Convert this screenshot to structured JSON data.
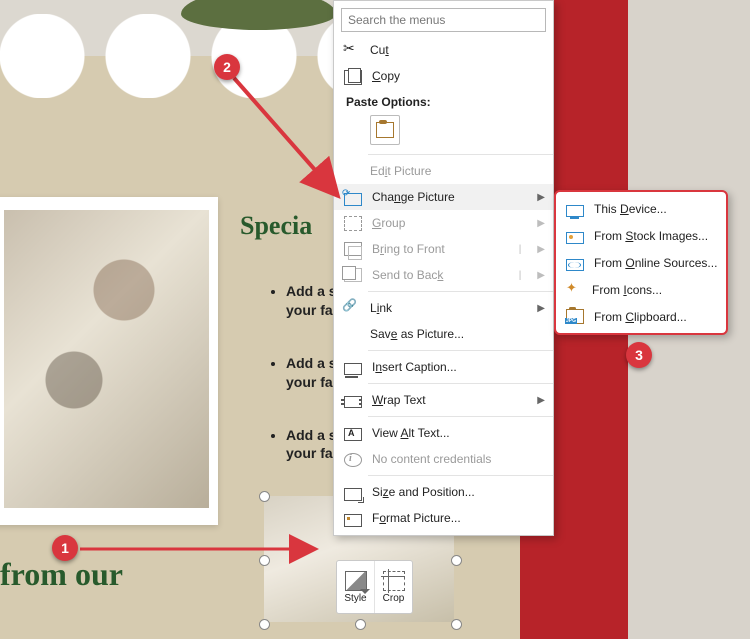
{
  "document": {
    "heading": "Specia",
    "bullets": [
      "Add a s",
      "Add a s",
      "Add a s"
    ],
    "bullet_line2": "your fa",
    "footer_heading": "from our"
  },
  "context_menu": {
    "search_placeholder": "Search the menus",
    "cut": "Cut",
    "copy": "Copy",
    "paste_options_header": "Paste Options:",
    "edit_picture": "Edit Picture",
    "change_picture": "Change Picture",
    "group": "Group",
    "bring_to_front": "Bring to Front",
    "send_to_back": "Send to Back",
    "link": "Link",
    "save_as_picture": "Save as Picture...",
    "insert_caption": "Insert Caption...",
    "wrap_text": "Wrap Text",
    "view_alt_text": "View Alt Text...",
    "no_content_credentials": "No content credentials",
    "size_and_position": "Size and Position...",
    "format_picture": "Format Picture..."
  },
  "submenu": {
    "this_device": "This Device...",
    "from_stock": "From Stock Images...",
    "from_online": "From Online Sources...",
    "from_icons": "From Icons...",
    "from_clipboard": "From Clipboard..."
  },
  "mini_toolbar": {
    "style": "Style",
    "crop": "Crop"
  },
  "callouts": {
    "one": "1",
    "two": "2",
    "three": "3"
  }
}
